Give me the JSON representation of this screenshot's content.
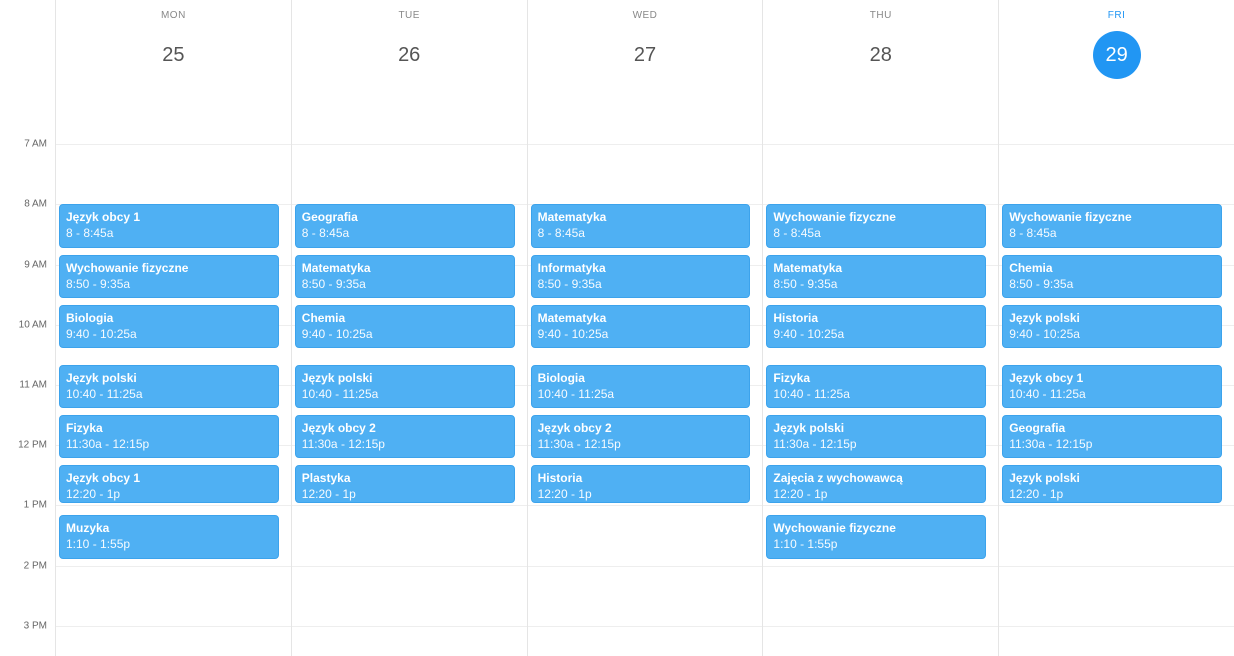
{
  "gridStartHour": 6,
  "hourPixels": 60.2,
  "headerHeight": 84,
  "timeLabels": [
    "7 AM",
    "8 AM",
    "9 AM",
    "10 AM",
    "11 AM",
    "12 PM",
    "1 PM",
    "2 PM",
    "3 PM"
  ],
  "timeLabelHours": [
    7,
    8,
    9,
    10,
    11,
    12,
    13,
    14,
    15
  ],
  "days": [
    {
      "dow": "MON",
      "date": "25",
      "current": false
    },
    {
      "dow": "TUE",
      "date": "26",
      "current": false
    },
    {
      "dow": "WED",
      "date": "27",
      "current": false
    },
    {
      "dow": "THU",
      "date": "28",
      "current": false
    },
    {
      "dow": "FRI",
      "date": "29",
      "current": true
    }
  ],
  "events": [
    {
      "day": 0,
      "title": "Język obcy 1",
      "time": "8 - 8:45a",
      "start": 8.0,
      "end": 8.75
    },
    {
      "day": 0,
      "title": "Wychowanie fizyczne",
      "time": "8:50 - 9:35a",
      "start": 8.833,
      "end": 9.583
    },
    {
      "day": 0,
      "title": "Biologia",
      "time": "9:40 - 10:25a",
      "start": 9.667,
      "end": 10.417
    },
    {
      "day": 0,
      "title": "Język polski",
      "time": "10:40 - 11:25a",
      "start": 10.667,
      "end": 11.417
    },
    {
      "day": 0,
      "title": "Fizyka",
      "time": "11:30a - 12:15p",
      "start": 11.5,
      "end": 12.25
    },
    {
      "day": 0,
      "title": "Język obcy 1",
      "time": "12:20 - 1p",
      "start": 12.333,
      "end": 13.0
    },
    {
      "day": 0,
      "title": "Muzyka",
      "time": "1:10 - 1:55p",
      "start": 13.167,
      "end": 13.917
    },
    {
      "day": 1,
      "title": "Geografia",
      "time": "8 - 8:45a",
      "start": 8.0,
      "end": 8.75
    },
    {
      "day": 1,
      "title": "Matematyka",
      "time": "8:50 - 9:35a",
      "start": 8.833,
      "end": 9.583
    },
    {
      "day": 1,
      "title": "Chemia",
      "time": "9:40 - 10:25a",
      "start": 9.667,
      "end": 10.417
    },
    {
      "day": 1,
      "title": "Język polski",
      "time": "10:40 - 11:25a",
      "start": 10.667,
      "end": 11.417
    },
    {
      "day": 1,
      "title": "Język obcy 2",
      "time": "11:30a - 12:15p",
      "start": 11.5,
      "end": 12.25
    },
    {
      "day": 1,
      "title": "Plastyka",
      "time": "12:20 - 1p",
      "start": 12.333,
      "end": 13.0
    },
    {
      "day": 2,
      "title": "Matematyka",
      "time": "8 - 8:45a",
      "start": 8.0,
      "end": 8.75
    },
    {
      "day": 2,
      "title": "Informatyka",
      "time": "8:50 - 9:35a",
      "start": 8.833,
      "end": 9.583
    },
    {
      "day": 2,
      "title": "Matematyka",
      "time": "9:40 - 10:25a",
      "start": 9.667,
      "end": 10.417
    },
    {
      "day": 2,
      "title": "Biologia",
      "time": "10:40 - 11:25a",
      "start": 10.667,
      "end": 11.417
    },
    {
      "day": 2,
      "title": "Język obcy 2",
      "time": "11:30a - 12:15p",
      "start": 11.5,
      "end": 12.25
    },
    {
      "day": 2,
      "title": "Historia",
      "time": "12:20 - 1p",
      "start": 12.333,
      "end": 13.0
    },
    {
      "day": 3,
      "title": "Wychowanie fizyczne",
      "time": "8 - 8:45a",
      "start": 8.0,
      "end": 8.75
    },
    {
      "day": 3,
      "title": "Matematyka",
      "time": "8:50 - 9:35a",
      "start": 8.833,
      "end": 9.583
    },
    {
      "day": 3,
      "title": "Historia",
      "time": "9:40 - 10:25a",
      "start": 9.667,
      "end": 10.417
    },
    {
      "day": 3,
      "title": "Fizyka",
      "time": "10:40 - 11:25a",
      "start": 10.667,
      "end": 11.417
    },
    {
      "day": 3,
      "title": "Język polski",
      "time": "11:30a - 12:15p",
      "start": 11.5,
      "end": 12.25
    },
    {
      "day": 3,
      "title": "Zajęcia z wychowawcą",
      "time": "12:20 - 1p",
      "start": 12.333,
      "end": 13.0
    },
    {
      "day": 3,
      "title": "Wychowanie fizyczne",
      "time": "1:10 - 1:55p",
      "start": 13.167,
      "end": 13.917
    },
    {
      "day": 4,
      "title": "Wychowanie fizyczne",
      "time": "8 - 8:45a",
      "start": 8.0,
      "end": 8.75
    },
    {
      "day": 4,
      "title": "Chemia",
      "time": "8:50 - 9:35a",
      "start": 8.833,
      "end": 9.583
    },
    {
      "day": 4,
      "title": "Język polski",
      "time": "9:40 - 10:25a",
      "start": 9.667,
      "end": 10.417
    },
    {
      "day": 4,
      "title": "Język obcy 1",
      "time": "10:40 - 11:25a",
      "start": 10.667,
      "end": 11.417
    },
    {
      "day": 4,
      "title": "Geografia",
      "time": "11:30a - 12:15p",
      "start": 11.5,
      "end": 12.25
    },
    {
      "day": 4,
      "title": "Język polski",
      "time": "12:20 - 1p",
      "start": 12.333,
      "end": 13.0
    }
  ]
}
